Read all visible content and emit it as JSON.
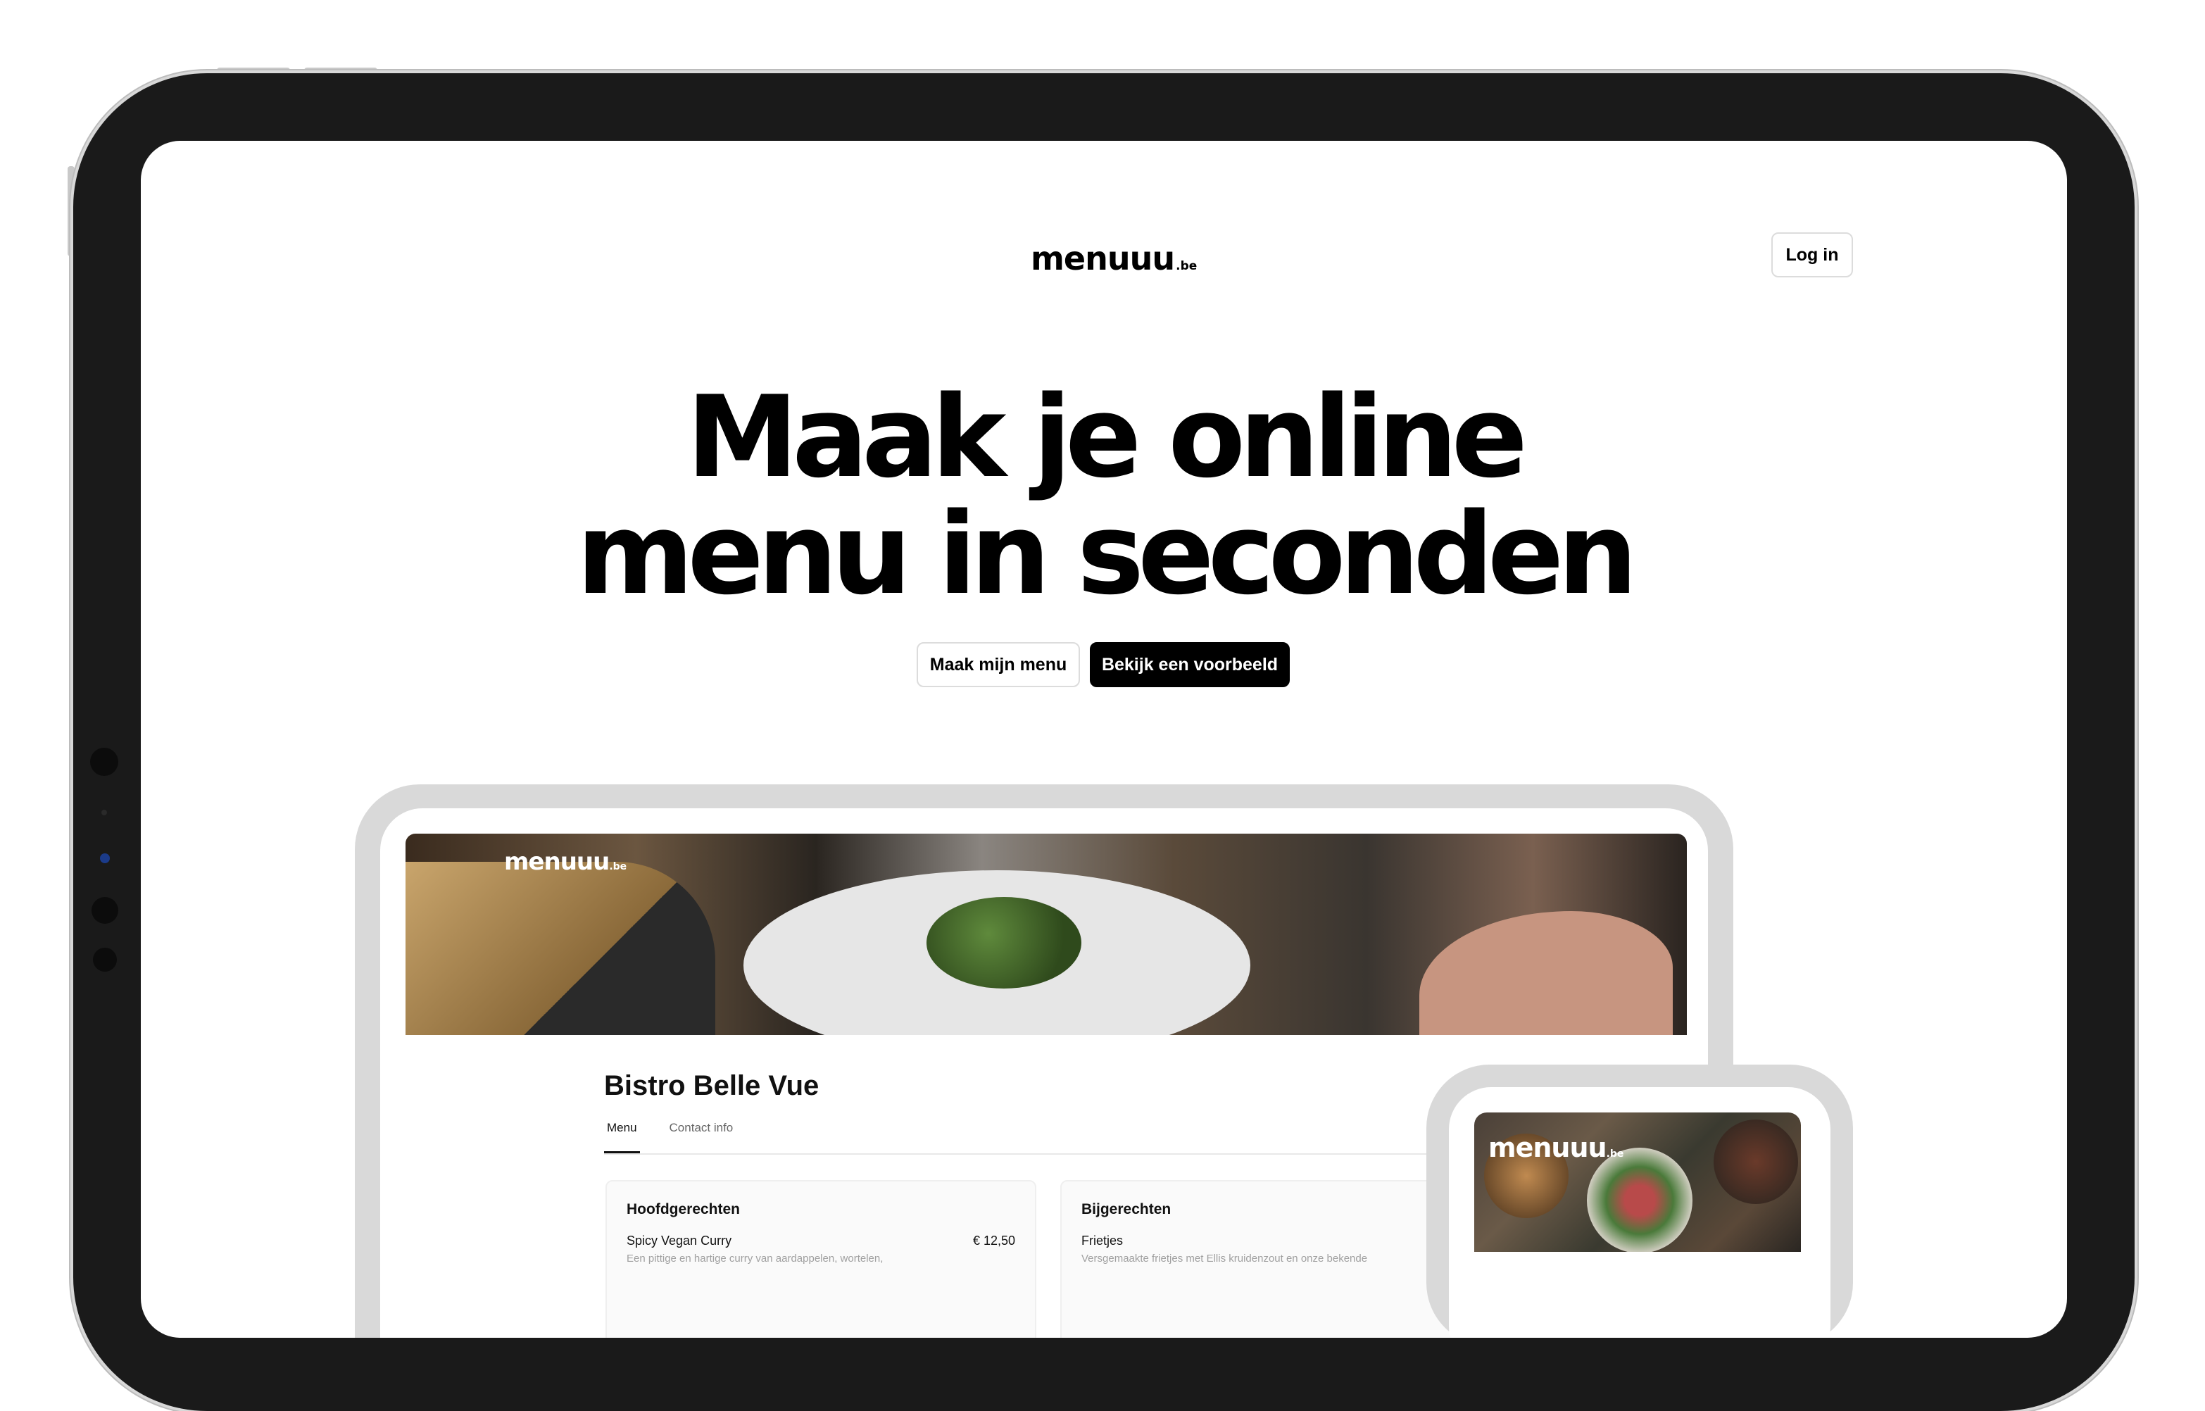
{
  "header": {
    "logo_main": "menuuu",
    "logo_tld": ".be",
    "login_label": "Log in"
  },
  "hero": {
    "line1": "Maak je online",
    "line2": "menu in seconden",
    "primary_cta": "Maak mijn menu",
    "secondary_cta": "Bekijk een voorbeeld"
  },
  "preview": {
    "banner_logo_main": "menuuu",
    "banner_logo_tld": ".be",
    "restaurant_name": "Bistro Belle Vue",
    "tabs": [
      {
        "label": "Menu",
        "active": true
      },
      {
        "label": "Contact info",
        "active": false
      }
    ],
    "cards": [
      {
        "title": "Hoofdgerechten",
        "item_name": "Spicy Vegan Curry",
        "item_price": "€ 12,50",
        "item_desc": "Een pittige en hartige curry van aardappelen, wortelen,"
      },
      {
        "title": "Bijgerechten",
        "item_name": "Frietjes",
        "item_price": "",
        "item_desc": "Versgemaakte frietjes met Ellis kruidenzout en onze bekende"
      }
    ]
  },
  "phone_preview": {
    "logo_main": "menuuu",
    "logo_tld": ".be"
  },
  "colors": {
    "accent": "#000000",
    "frame": "#1a1a1a",
    "mock_bezel": "#d9d9d9"
  }
}
